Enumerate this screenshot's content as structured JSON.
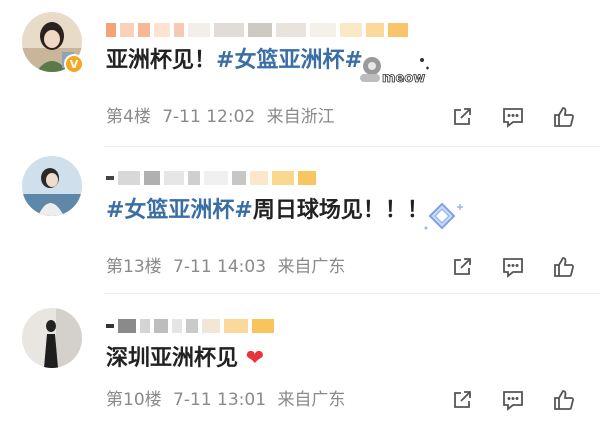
{
  "comments": [
    {
      "text_plain": "亚洲杯见！",
      "text_topic": "#女篮亚洲杯#",
      "sticker_text": "meow",
      "floor": "第4楼",
      "time": "7-11 12:02",
      "location": "来自浙江",
      "verified_badge": "V"
    },
    {
      "text_topic": "#女篮亚洲杯#",
      "text_plain": "周日球场见！！！",
      "floor": "第13楼",
      "time": "7-11 14:03",
      "location": "来自广东"
    },
    {
      "text_plain": "深圳亚洲杯见",
      "emoji": "❤",
      "floor": "第10楼",
      "time": "7-11 13:01",
      "location": "来自广东"
    }
  ],
  "icons": [
    "share-icon",
    "comment-icon",
    "like-icon"
  ],
  "colors": {
    "topic": "#3a6ea5",
    "meta": "#8a8a8a",
    "heart": "#e8343a",
    "badge": "#f5a623"
  }
}
